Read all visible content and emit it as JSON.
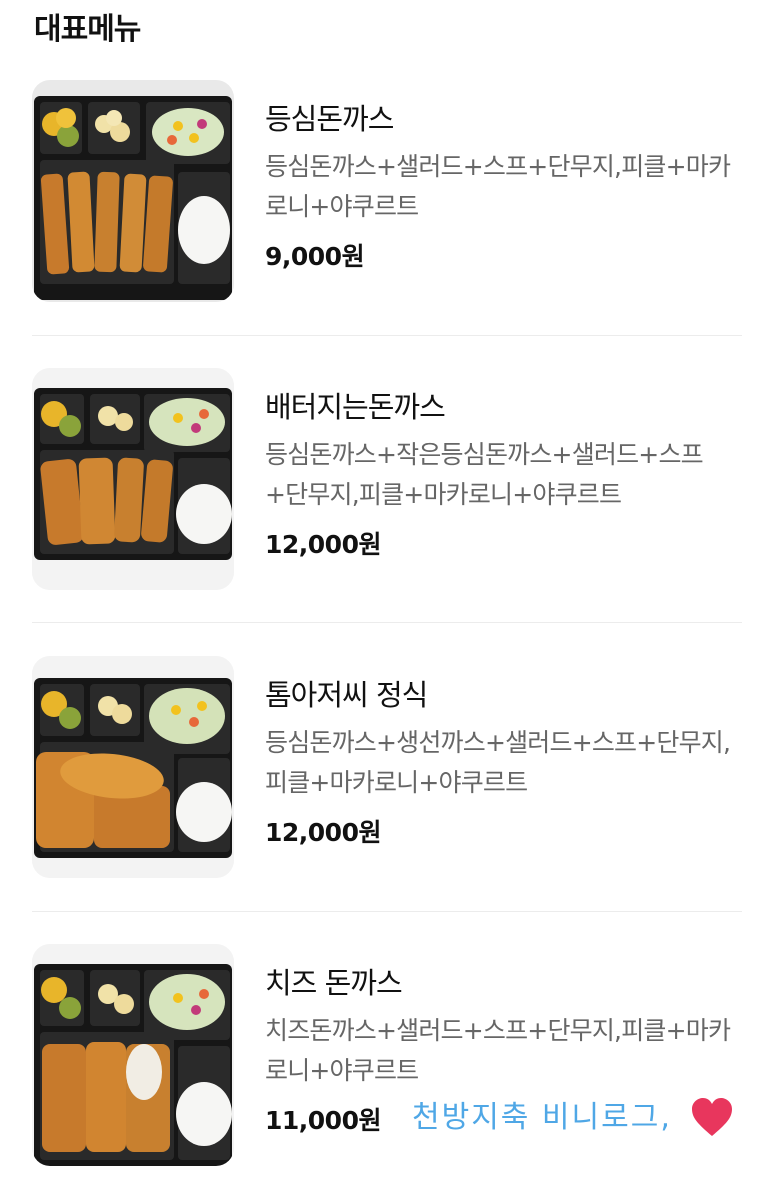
{
  "section": {
    "title": "대표메뉴"
  },
  "menu": [
    {
      "name": "등심돈까스",
      "description": "등심돈까스+샐러드+스프+단무지,피클+마카로니+야쿠르트",
      "price": "9,000원"
    },
    {
      "name": "배터지는돈까스",
      "description": "등심돈까스+작은등심돈까스+샐러드+스프+단무지,피클+마카로니+야쿠르트",
      "price": "12,000원"
    },
    {
      "name": "톰아저씨 정식",
      "description": "등심돈까스+생선까스+샐러드+스프+단무지,피클+마카로니+야쿠르트",
      "price": "12,000원"
    },
    {
      "name": "치즈 돈까스",
      "description": "치즈돈까스+샐러드+스프+단무지,피클+마카로니+야쿠르트",
      "price": "11,000원"
    }
  ],
  "watermark": {
    "text": "천방지축 비니로그,"
  },
  "colors": {
    "accent_text": "#111111",
    "description_text": "#666666",
    "watermark": "#4fa7e6",
    "heart": "#e8365d"
  }
}
